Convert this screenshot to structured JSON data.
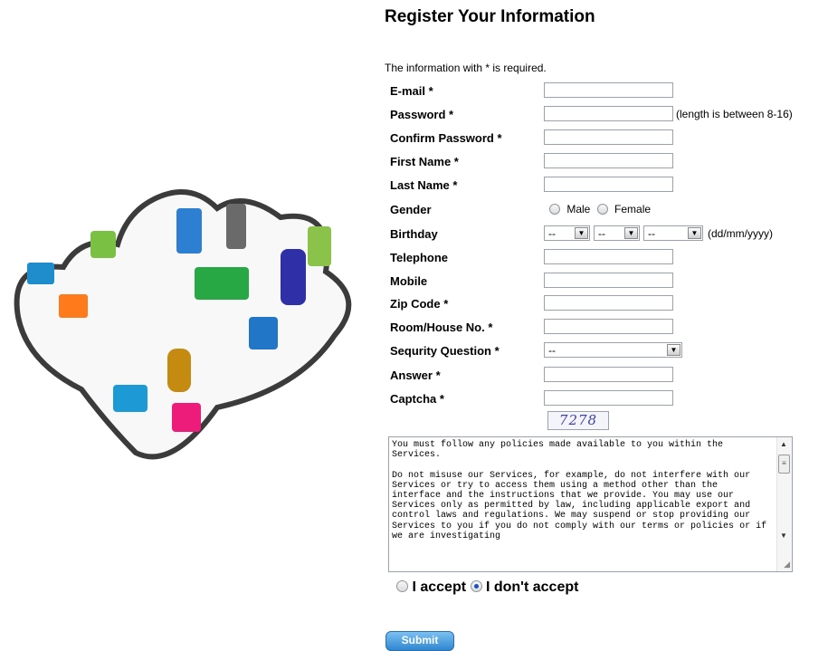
{
  "page": {
    "title": "Register Your Information",
    "required_note": "The information with * is required."
  },
  "fields": {
    "email": {
      "label": "E-mail *",
      "value": ""
    },
    "password": {
      "label": "Password *",
      "value": "",
      "hint": "(length is between 8-16)"
    },
    "confirm_password": {
      "label": "Confirm Password *",
      "value": ""
    },
    "first_name": {
      "label": "First Name *",
      "value": ""
    },
    "last_name": {
      "label": "Last Name *",
      "value": ""
    },
    "gender": {
      "label": "Gender",
      "options": [
        "Male",
        "Female"
      ],
      "selected": null
    },
    "birthday": {
      "label": "Birthday",
      "day": "--",
      "month": "--",
      "year": "--",
      "format": "(dd/mm/yyyy)"
    },
    "telephone": {
      "label": "Telephone",
      "value": ""
    },
    "mobile": {
      "label": "Mobile",
      "value": ""
    },
    "zip_code": {
      "label": "Zip Code *",
      "value": ""
    },
    "room_house": {
      "label": "Room/House No. *",
      "value": ""
    },
    "security_question": {
      "label": "Sequrity Question *",
      "value": "--"
    },
    "answer": {
      "label": "Answer *",
      "value": ""
    },
    "captcha": {
      "label": "Captcha *",
      "value": "",
      "image_text": "7278"
    }
  },
  "terms": {
    "text": "You must follow any policies made available to you within the Services.\n\nDo not misuse our Services, for example, do not interfere with our Services or try to access them using a method other than the interface and the instructions that we provide. You may use our Services only as permitted by law, including applicable export and control laws and regulations. We may suspend or stop providing our Services to you if you do not comply with our terms or policies or if we are investigating"
  },
  "agreement": {
    "accept_label": "I accept",
    "decline_label": "I don't accept",
    "selected": "decline"
  },
  "submit_label": "Submit",
  "icons": [
    "puzzle-heart-illustration",
    "chevron-down-icon",
    "scroll-up-icon",
    "scroll-down-icon",
    "resize-grip-icon"
  ],
  "colors": {
    "submit_top": "#7cc0f2",
    "submit_bottom": "#2e87d0",
    "radio_selected": "#1e4fbf",
    "captcha_text": "#4040a8"
  }
}
